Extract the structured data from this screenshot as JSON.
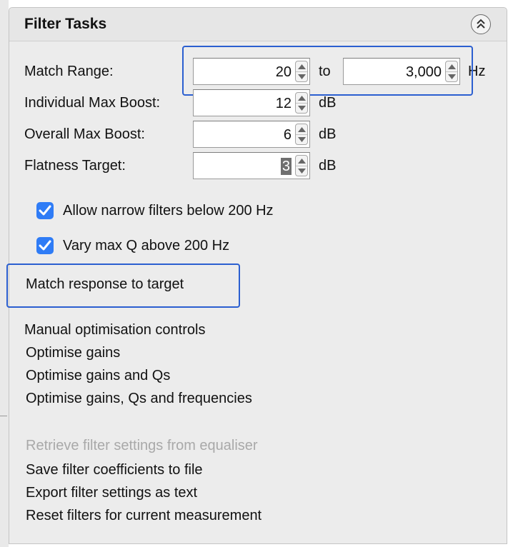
{
  "panel": {
    "title": "Filter Tasks",
    "collapse_icon": "double-chevron-up-icon"
  },
  "match_range": {
    "label": "Match Range:",
    "from_value": "20",
    "to_label": "to",
    "to_value": "3,000",
    "unit": "Hz"
  },
  "individual_max_boost": {
    "label": "Individual Max Boost:",
    "value": "12",
    "unit": "dB"
  },
  "overall_max_boost": {
    "label": "Overall Max Boost:",
    "value": "6",
    "unit": "dB"
  },
  "flatness_target": {
    "label": "Flatness Target:",
    "value": "3",
    "unit": "dB"
  },
  "options": {
    "allow_narrow": {
      "label": "Allow narrow filters below 200 Hz",
      "checked": true
    },
    "vary_max_q": {
      "label": "Vary max Q above 200 Hz",
      "checked": true
    }
  },
  "actions": {
    "match_response": "Match response to target",
    "manual_controls": "Manual optimisation controls",
    "optimise_gains": "Optimise gains",
    "optimise_gains_qs": "Optimise gains and Qs",
    "optimise_gains_qs_freqs": "Optimise gains, Qs and frequencies",
    "retrieve_settings": "Retrieve filter settings from equaliser",
    "save_coefficients": "Save filter coefficients to file",
    "export_settings": "Export filter settings as text",
    "reset_filters": "Reset filters for current measurement"
  },
  "colors": {
    "highlight": "#2b5fd0",
    "checkbox": "#2f7cf6",
    "disabled_text": "#a9a9a9"
  }
}
